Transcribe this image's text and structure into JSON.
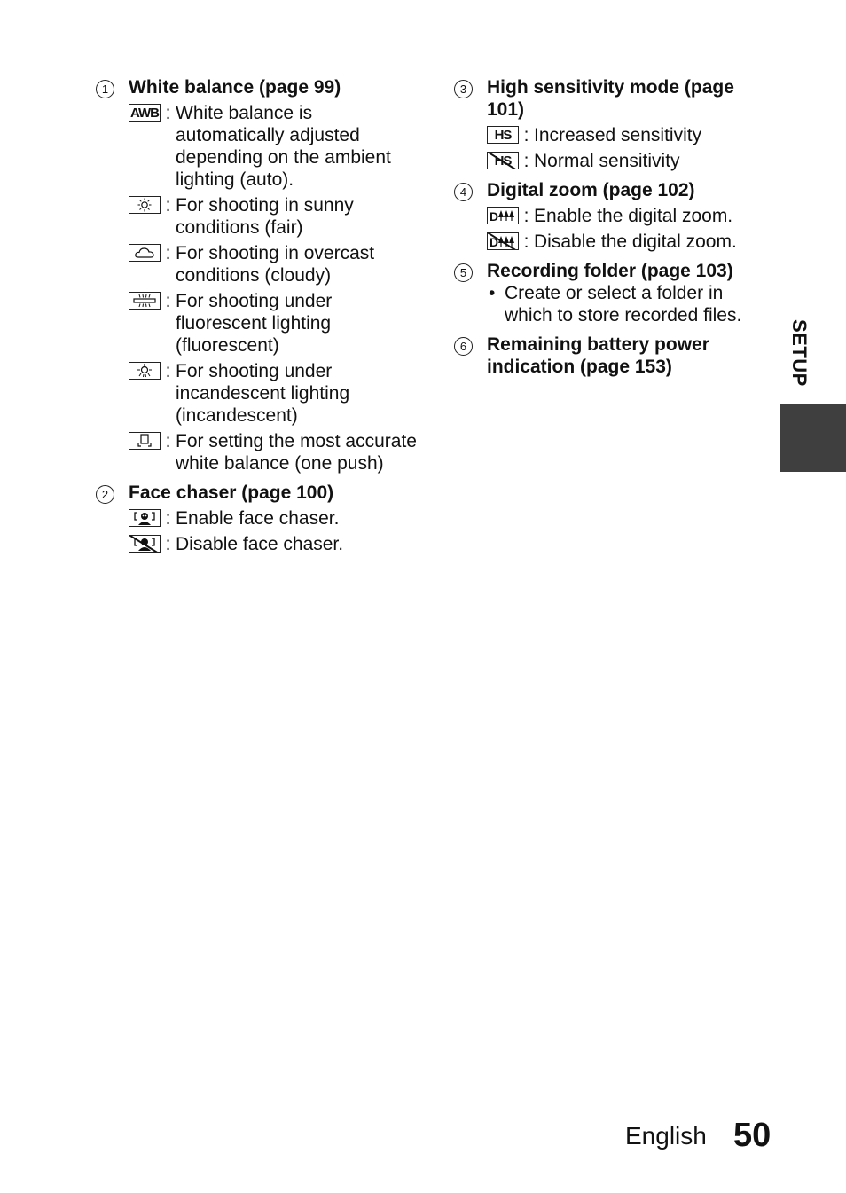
{
  "side_tab": {
    "label": "SETUP"
  },
  "footer": {
    "language": "English",
    "page_number": "50"
  },
  "left_column": {
    "sections": [
      {
        "number": "1",
        "title": "White balance (page 99)",
        "entries": [
          {
            "icon": "awb-icon",
            "icon_text": "AWB",
            "text": "White balance is automatically adjusted depending on the ambient lighting (auto)."
          },
          {
            "icon": "sun-icon",
            "icon_text": "☼",
            "text": "For shooting in sunny conditions (fair)"
          },
          {
            "icon": "cloud-icon",
            "icon_text": "☁",
            "text": "For shooting in overcast conditions (cloudy)"
          },
          {
            "icon": "fluorescent-icon",
            "icon_text": "",
            "text": "For shooting under fluorescent lighting (fluorescent)"
          },
          {
            "icon": "bulb-icon",
            "icon_text": "",
            "text": "For shooting under incandescent lighting (incandescent)"
          },
          {
            "icon": "one-push-icon",
            "icon_text": "",
            "text": "For setting the most accurate white balance (one push)"
          }
        ]
      },
      {
        "number": "2",
        "title": "Face chaser (page 100)",
        "entries": [
          {
            "icon": "face-chaser-on-icon",
            "icon_text": "[☺]",
            "text": "Enable face chaser."
          },
          {
            "icon": "face-chaser-off-icon",
            "icon_text": "[☺]",
            "text": "Disable face chaser."
          }
        ]
      }
    ]
  },
  "right_column": {
    "sections": [
      {
        "number": "3",
        "title": "High sensitivity mode (page 101)",
        "entries": [
          {
            "icon": "hs-on-icon",
            "icon_text": "HS",
            "text": "Increased sensitivity"
          },
          {
            "icon": "hs-off-icon",
            "icon_text": "HS",
            "text": "Normal sensitivity"
          }
        ]
      },
      {
        "number": "4",
        "title": "Digital zoom (page 102)",
        "entries": [
          {
            "icon": "digital-zoom-on-icon",
            "icon_text": "D▲▲▲",
            "text": "Enable the digital zoom."
          },
          {
            "icon": "digital-zoom-off-icon",
            "icon_text": "D▲▲▲",
            "text": "Disable the digital zoom."
          }
        ]
      },
      {
        "number": "5",
        "title": "Recording folder (page 103)",
        "bullets": [
          "Create or select a folder in which to store recorded files."
        ]
      },
      {
        "number": "6",
        "title": "Remaining battery power indication (page 153)"
      }
    ]
  }
}
